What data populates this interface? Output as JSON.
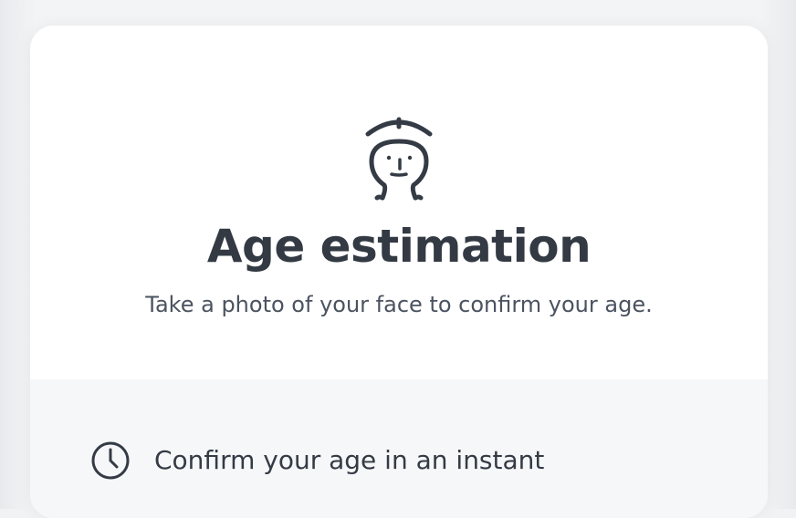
{
  "card": {
    "icon": "face-scan-icon",
    "title": "Age estimation",
    "subtitle": "Take a photo of your face to confirm your age."
  },
  "features": [
    {
      "icon": "clock-icon",
      "text": "Confirm your age in an instant"
    }
  ],
  "colors": {
    "background": "#f1f2f4",
    "card": "#ffffff",
    "features_panel": "#f6f7f9",
    "title": "#333a43",
    "text": "#4b5360",
    "icon": "#343b45"
  }
}
